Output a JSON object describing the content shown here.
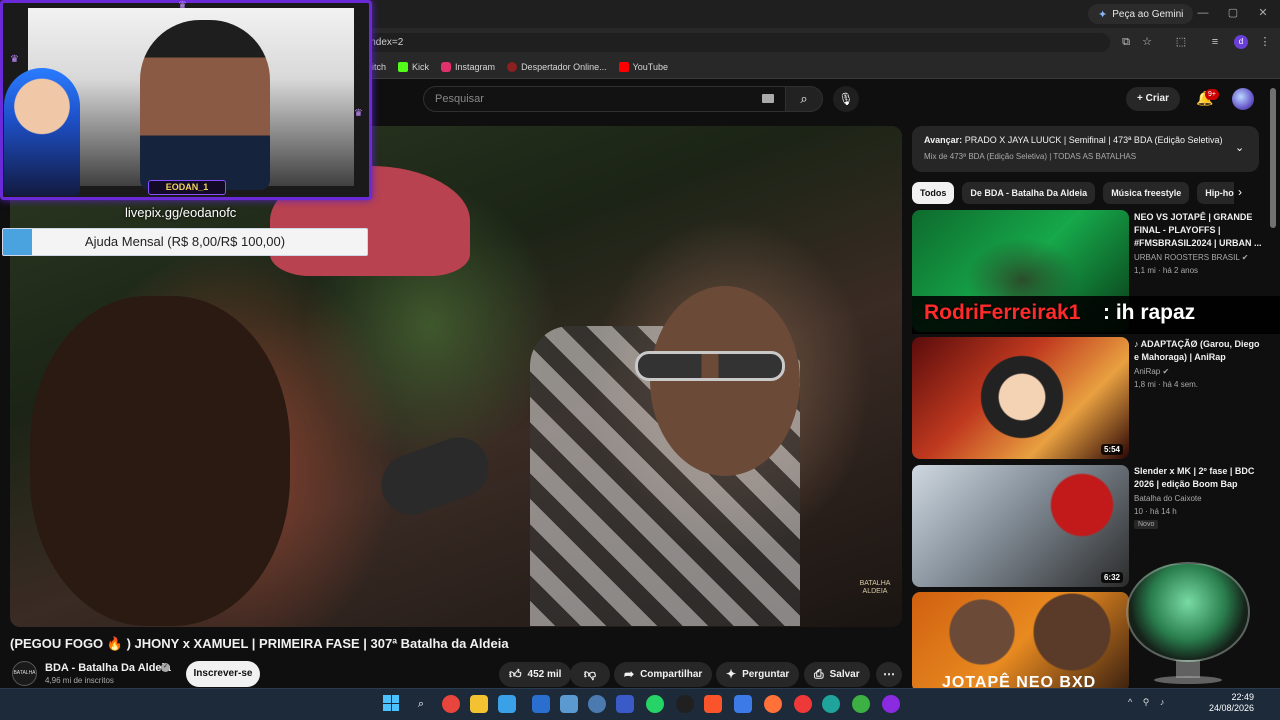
{
  "browser": {
    "gemini_button": "Peça ao Gemini",
    "url_fragment": "index=2",
    "profile_initial": "d",
    "bookmarks": [
      {
        "label": "itch",
        "color": "#000000"
      },
      {
        "label": "Kick",
        "color": "#53fc18"
      },
      {
        "label": "Instagram",
        "color": "#e1306c"
      },
      {
        "label": "Despertador Online...",
        "color": "#8a2020"
      },
      {
        "label": "YouTube",
        "color": "#ff0000"
      }
    ]
  },
  "youtube": {
    "search_placeholder": "Pesquisar",
    "create_label": "Criar",
    "notifications_badge": "9+"
  },
  "overlay": {
    "streamer_name": "EODAN_1",
    "livepix_url": "livepix.gg/eodanofc",
    "goal_text": "Ajuda Mensal (R$ 8,00/R$ 100,00)",
    "goal_progress": 0.08,
    "chat_user": "RodriFerreirak1",
    "chat_message": ": ih rapaz"
  },
  "video": {
    "title": "(PEGOU FOGO 🔥 ) JHONY x XAMUEL | PRIMEIRA FASE | 307ª Batalha da Aldeia",
    "channel_name": "BDA - Batalha Da Aldeia",
    "channel_avatar_text": "BATALHA ALDEIA",
    "subscribers": "4,96 mi de inscritos",
    "subscribe_label": "Inscrever-se",
    "likes": "452 mil",
    "share_label": "Compartilhar",
    "ask_label": "Perguntar",
    "save_label": "Salvar",
    "watermark": "BATALHA ALDEIA"
  },
  "autoplay": {
    "prefix": "Avançar:",
    "title": "PRADO X JAYA LUUCK | Semifinal | 473ª BDA (Edição Seletiva)",
    "subtitle": "Mix de 473ª BDA (Edição Seletiva) | TODAS AS BATALHAS"
  },
  "chips": [
    "Todos",
    "De BDA - Batalha Da Aldeia",
    "Música freestyle",
    "Hip-hop"
  ],
  "recommendations": [
    {
      "title": "NEO VS JOTAPÊ | GRANDE FINAL - PLAYOFFS | #FMSBRASIL2024 | URBAN ...",
      "channel": "URBAN ROOSTERS BRASIL",
      "meta": "1,1 mi · há 2 anos",
      "duration": ""
    },
    {
      "title": "♪ ADAPTAÇÃØ (Garou, Diego e Mahoraga) | AniRap",
      "channel": "AniRap",
      "meta": "1,8 mi · há 4 sem.",
      "duration": "5:54"
    },
    {
      "title": "Slender x MK | 2º fase | BDC 2026 | edição Boom Bap",
      "channel": "Batalha do Caixote",
      "meta": "10 · há 14 h",
      "duration": "6:32",
      "badge": "Novo"
    },
    {
      "title": "",
      "channel": "",
      "meta": "",
      "thumb_text": "JOTAPÊ NEO BXD"
    }
  ],
  "taskbar": {
    "time": "22:49",
    "date": "24/08/2026"
  }
}
